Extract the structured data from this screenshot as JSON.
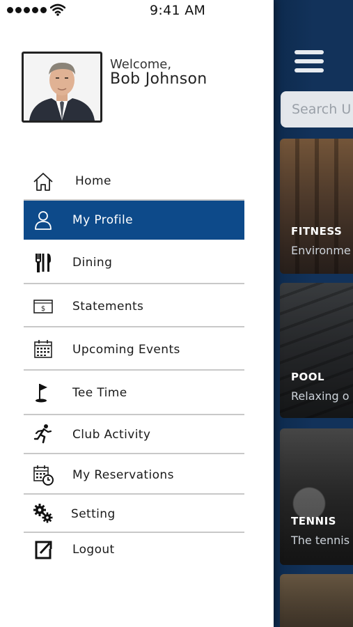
{
  "status_bar": {
    "time": "9:41 AM",
    "signal_icon": "signal-dots-icon",
    "wifi_icon": "wifi-icon"
  },
  "profile": {
    "welcome": "Welcome,",
    "name": "Bob Johnson",
    "avatar_icon": "user-photo"
  },
  "menu": {
    "items": [
      {
        "label": "Home",
        "icon": "home-icon",
        "active": false
      },
      {
        "label": "My Profile",
        "icon": "user-icon",
        "active": true
      },
      {
        "label": "Dining",
        "icon": "dining-icon",
        "active": false
      },
      {
        "label": "Statements",
        "icon": "bill-icon",
        "active": false
      },
      {
        "label": "Upcoming Events",
        "icon": "calendar-icon",
        "active": false
      },
      {
        "label": "Tee Time",
        "icon": "golf-flag-icon",
        "active": false
      },
      {
        "label": "Club Activity",
        "icon": "running-person-icon",
        "active": false
      },
      {
        "label": "My Reservations",
        "icon": "calendar-clock-icon",
        "active": false
      },
      {
        "label": "Setting",
        "icon": "gears-icon",
        "active": false
      },
      {
        "label": "Logout",
        "icon": "logout-icon",
        "active": false
      }
    ]
  },
  "background": {
    "search_placeholder": "Search U",
    "cards": [
      {
        "title": "FITNESS",
        "subtitle": "Environme"
      },
      {
        "title": "POOL",
        "subtitle": "Relaxing o"
      },
      {
        "title": "TENNIS",
        "subtitle": "The tennis"
      }
    ]
  },
  "colors": {
    "accent": "#0d4a8a",
    "background_app": "#12325a",
    "divider": "#c8c8c8"
  }
}
